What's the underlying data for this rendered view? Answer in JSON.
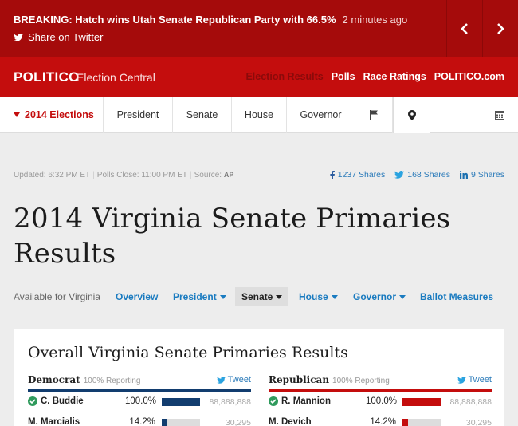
{
  "breaking": {
    "headline": "BREAKING: Hatch wins Utah Senate Republican Party with 66.5%",
    "time": "2 minutes ago",
    "share": "Share on Twitter"
  },
  "topnav": {
    "logo": "POLITICO",
    "subtitle": "Election Central",
    "links": [
      "Election Results",
      "Polls",
      "Race Ratings",
      "POLITICO.com"
    ]
  },
  "secnav": {
    "elections": "2014 Elections",
    "items": [
      "President",
      "Senate",
      "House",
      "Governor"
    ]
  },
  "meta": {
    "updated": "Updated: 6:32 PM ET",
    "polls_close": "Polls Close: 11:00 PM ET",
    "source_label": "Source:",
    "source": "AP",
    "facebook": "1237 Shares",
    "twitter": "168 Shares",
    "linkedin": "9 Shares"
  },
  "title": "2014 Virginia Senate Primaries Results",
  "statemenu": {
    "available": "Available for Virginia",
    "items": [
      "Overview",
      "President",
      "Senate",
      "House",
      "Governor",
      "Ballot Measures"
    ]
  },
  "card": {
    "heading": "Overall Virginia Senate Primaries Results",
    "tweet": "Tweet",
    "dem": {
      "name": "Democrat",
      "reporting": "100% Reporting",
      "rows": [
        {
          "cand": "C. Buddie",
          "pct": "100.0%",
          "share": 1.0,
          "votes": "88,888,888"
        },
        {
          "cand": "M. Marcialis",
          "pct": "14.2%",
          "share": 0.142,
          "votes": "30,295"
        }
      ]
    },
    "rep": {
      "name": "Republican",
      "reporting": "100% Reporting",
      "rows": [
        {
          "cand": "R. Mannion",
          "pct": "100.0%",
          "share": 1.0,
          "votes": "88,888,888"
        },
        {
          "cand": "M. Devich",
          "pct": "14.2%",
          "share": 0.142,
          "votes": "30,295"
        }
      ]
    },
    "colors": {
      "dem": "#123d6f",
      "rep": "#c40d0d",
      "winner": "#2f9a5c"
    }
  }
}
